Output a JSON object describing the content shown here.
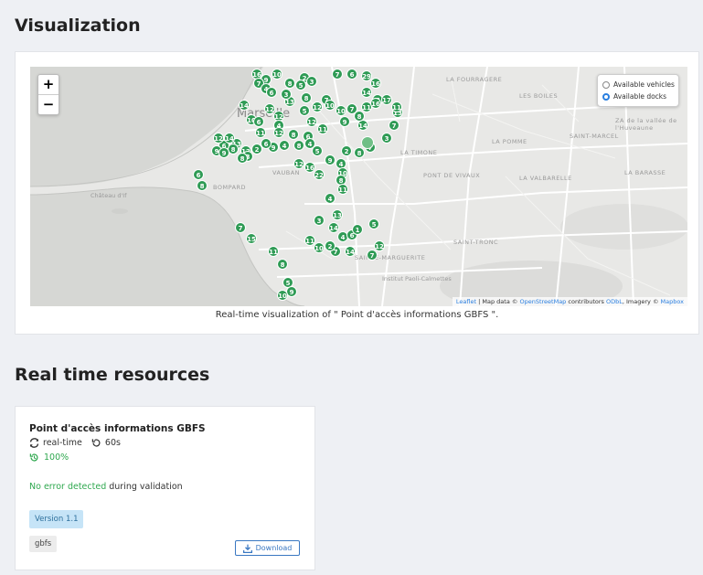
{
  "visualization": {
    "title": "Visualization",
    "caption": "Real-time visualization of \" Point d'accès informations GBFS \".",
    "zoom_in": "+",
    "zoom_out": "−",
    "layers": {
      "vehicles_label": "Available vehicles",
      "docks_label": "Available docks",
      "selected": "Available docks"
    },
    "attribution": {
      "leaflet": "Leaflet",
      "map_data": "| Map data ©",
      "osm": "OpenStreetMap",
      "contributors": "contributors",
      "odbl": "ODbL",
      "imagery": ", Imagery ©",
      "mapbox": "Mapbox"
    },
    "place_labels": {
      "fourragere": "LA FOURRAGERE",
      "boiles": "LES BOILES",
      "vallee": "ZA de la vallée de l'Huveaune",
      "pomme": "LA POMME",
      "timone": "LA TIMONE",
      "saint_marcel": "SAINT-MARCEL",
      "barasse": "LA BARASSE",
      "pont_vivaux": "PONT DE VIVAUX",
      "valbarelle": "LA VALBARELLE",
      "vauban": "VAUBAN",
      "bompard": "BOMPARD",
      "chateau": "Château d'If",
      "saint_tronc": "SAINT-TRONC",
      "sainte_marguerite": "SAINTE-MARGUERITE",
      "institut": "Institut Paoli-Calmettes",
      "marseille": "Marseille"
    },
    "markers": [
      "16",
      "9",
      "10",
      "7",
      "4",
      "6",
      "2",
      "7",
      "6",
      "3",
      "29",
      "5",
      "8",
      "16",
      "14",
      "7",
      "14",
      "10",
      "12",
      "13",
      "12",
      "5",
      "3",
      "7",
      "8",
      "10",
      "12",
      "4",
      "6",
      "12",
      "11",
      "9",
      "14",
      "10",
      "8",
      "7",
      "11",
      "12",
      "8",
      "6",
      "8",
      "9",
      "6",
      "5",
      "4",
      "12",
      "4",
      "13",
      "8",
      "6",
      "9",
      "12",
      "14",
      "9",
      "2",
      "3",
      "8",
      "12",
      "16",
      "22",
      "9",
      "4",
      "2",
      "8",
      "7",
      "3",
      "7",
      "11",
      "13",
      "17",
      "11",
      "16",
      "6",
      "8",
      "10",
      "8",
      "11",
      "4",
      "13",
      "3",
      "14",
      "4",
      "6",
      "1",
      "5",
      "7",
      "15",
      "11",
      "11",
      "10",
      "7",
      "7",
      "12",
      "2",
      "14",
      "8",
      "5",
      "9",
      "10"
    ]
  },
  "realtime": {
    "title": "Real time resources",
    "resource": {
      "name": "Point d'accès informations GBFS",
      "type": "real-time",
      "interval": "60s",
      "availability": "100%",
      "validation_ok": "No error detected",
      "validation_rest": " during validation",
      "version_tag": "Version 1.1",
      "format_tag": "gbfs",
      "download_label": "Download"
    }
  },
  "colors": {
    "marker_green": "#2f9b55",
    "success_green": "#2fa84f",
    "link_blue": "#3a78c2",
    "version_bg": "#c6e4f7"
  }
}
